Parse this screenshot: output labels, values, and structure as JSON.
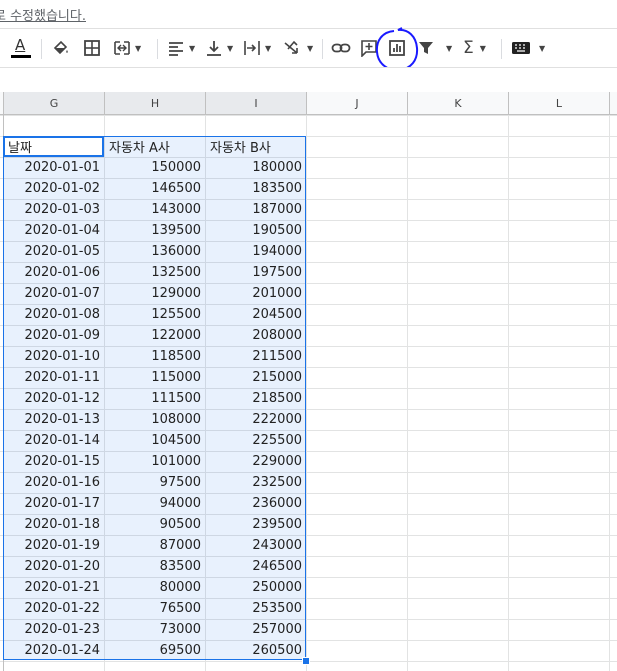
{
  "banner": {
    "text": "로 수정했습니다."
  },
  "toolbar": {
    "text_color_label": "A",
    "icons": [
      "text-color",
      "fill-color",
      "borders",
      "merge",
      "align",
      "valign",
      "wrap",
      "rotate",
      "link",
      "comment",
      "chart",
      "filter",
      "functions",
      "input-tools"
    ]
  },
  "columns": [
    "G",
    "H",
    "I",
    "J",
    "K",
    "L"
  ],
  "table": {
    "headers": [
      "날짜",
      "자동차 A사",
      "자동차 B사"
    ],
    "rows": [
      [
        "2020-01-01",
        "150000",
        "180000"
      ],
      [
        "2020-01-02",
        "146500",
        "183500"
      ],
      [
        "2020-01-03",
        "143000",
        "187000"
      ],
      [
        "2020-01-04",
        "139500",
        "190500"
      ],
      [
        "2020-01-05",
        "136000",
        "194000"
      ],
      [
        "2020-01-06",
        "132500",
        "197500"
      ],
      [
        "2020-01-07",
        "129000",
        "201000"
      ],
      [
        "2020-01-08",
        "125500",
        "204500"
      ],
      [
        "2020-01-09",
        "122000",
        "208000"
      ],
      [
        "2020-01-10",
        "118500",
        "211500"
      ],
      [
        "2020-01-11",
        "115000",
        "215000"
      ],
      [
        "2020-01-12",
        "111500",
        "218500"
      ],
      [
        "2020-01-13",
        "108000",
        "222000"
      ],
      [
        "2020-01-14",
        "104500",
        "225500"
      ],
      [
        "2020-01-15",
        "101000",
        "229000"
      ],
      [
        "2020-01-16",
        "97500",
        "232500"
      ],
      [
        "2020-01-17",
        "94000",
        "236000"
      ],
      [
        "2020-01-18",
        "90500",
        "239500"
      ],
      [
        "2020-01-19",
        "87000",
        "243000"
      ],
      [
        "2020-01-20",
        "83500",
        "246500"
      ],
      [
        "2020-01-21",
        "80000",
        "250000"
      ],
      [
        "2020-01-22",
        "76500",
        "253500"
      ],
      [
        "2020-01-23",
        "73000",
        "257000"
      ],
      [
        "2020-01-24",
        "69500",
        "260500"
      ]
    ]
  },
  "colors": {
    "selection": "#1a73e8",
    "annotation_circle": "#1a1aff"
  }
}
